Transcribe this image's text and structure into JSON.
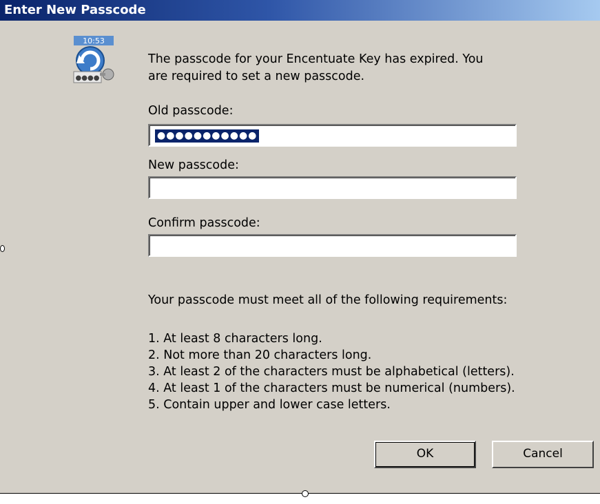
{
  "window": {
    "title": "Enter New Passcode"
  },
  "icon": {
    "name": "encentuate-key-icon"
  },
  "message": {
    "line1": "The passcode for your Encentuate Key has expired. You",
    "line2": "are required to set a new passcode."
  },
  "fields": {
    "old_label": "Old passcode:",
    "old_value": "●●●●●●●●●●●",
    "new_label": "New passcode:",
    "new_value": "",
    "confirm_label": "Confirm passcode:",
    "confirm_value": ""
  },
  "requirements": {
    "intro": "Your passcode must meet all of the following requirements:",
    "items": [
      "1. At least 8 characters long.",
      "2. Not more than 20 characters long.",
      "3. At least 2 of the characters must be alphabetical (letters).",
      "4. At least 1 of the characters must be numerical (numbers).",
      "5. Contain upper and lower case letters."
    ]
  },
  "buttons": {
    "ok_label": "OK",
    "cancel_label": "Cancel"
  },
  "colors": {
    "titlebar_start": "#0a246a",
    "titlebar_end": "#a6caf0",
    "dialog_face": "#d4d0c8",
    "selection": "#0a246a"
  }
}
